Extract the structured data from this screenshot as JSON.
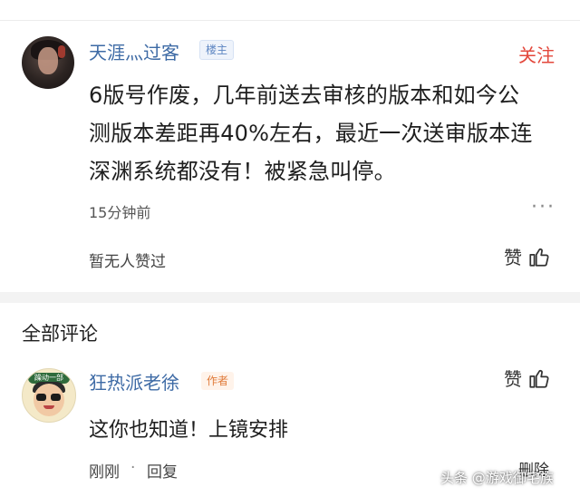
{
  "original_post": {
    "username": "天涯灬过客",
    "host_badge": "楼主",
    "follow_label": "关注",
    "content_lines": [
      "6版号作废，几年前送去审核的版本和如今公",
      "测版本差距再40%左右，最近一次送审版本连",
      "深渊系统都没有！被紧急叫停。"
    ],
    "time": "15分钟前",
    "more_icon": "···",
    "likes_text": "暂无人赞过",
    "like_label": "赞"
  },
  "comments_section": {
    "title": "全部评论"
  },
  "comment": {
    "username": "狂热派老徐",
    "author_badge": "作者",
    "avatar_banner": "躁动一部",
    "like_label": "赞",
    "text": "这你也知道！上镜安排",
    "time": "刚刚",
    "separator": "·",
    "reply_label": "回复",
    "delete_label": "删除"
  },
  "watermark": "头条 @游戏御宅族",
  "colors": {
    "username": "#3d6aa5",
    "follow": "#e3473b",
    "author_badge": "#e07b3a"
  }
}
